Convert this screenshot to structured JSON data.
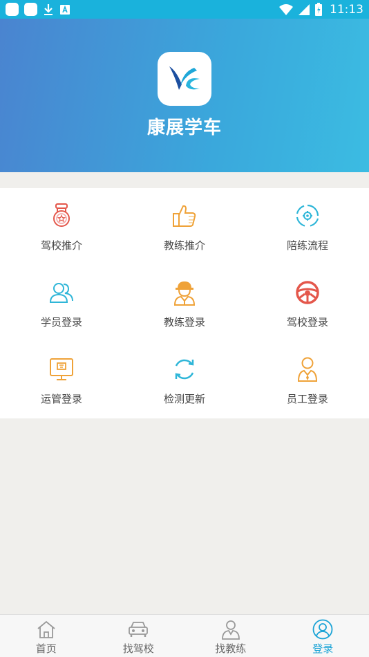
{
  "status_bar": {
    "time": "11:13"
  },
  "hero": {
    "app_name": "康展学车"
  },
  "grid": {
    "items": [
      {
        "label": "驾校推介",
        "icon": "medal-icon",
        "color": "#e4574b"
      },
      {
        "label": "教练推介",
        "icon": "thumbs-up-icon",
        "color": "#efa238"
      },
      {
        "label": "陪练流程",
        "icon": "gear-cycle-icon",
        "color": "#2fb6d8"
      },
      {
        "label": "学员登录",
        "icon": "users-icon",
        "color": "#2fb6d8"
      },
      {
        "label": "教练登录",
        "icon": "coach-helmet-icon",
        "color": "#efa238"
      },
      {
        "label": "驾校登录",
        "icon": "steering-wheel-icon",
        "color": "#e4574b"
      },
      {
        "label": "运管登录",
        "icon": "monitor-icon",
        "color": "#efa238"
      },
      {
        "label": "检测更新",
        "icon": "refresh-icon",
        "color": "#2fb6d8"
      },
      {
        "label": "员工登录",
        "icon": "staff-icon",
        "color": "#efa238"
      }
    ]
  },
  "tabbar": {
    "tabs": [
      {
        "label": "首页",
        "icon": "home-icon"
      },
      {
        "label": "找驾校",
        "icon": "car-icon"
      },
      {
        "label": "找教练",
        "icon": "coach-icon"
      },
      {
        "label": "登录",
        "icon": "user-circle-icon",
        "active": true
      }
    ]
  },
  "colors": {
    "accent": "#1aa3d6",
    "hero_start": "#4a84d0",
    "hero_end": "#3bbce2"
  }
}
